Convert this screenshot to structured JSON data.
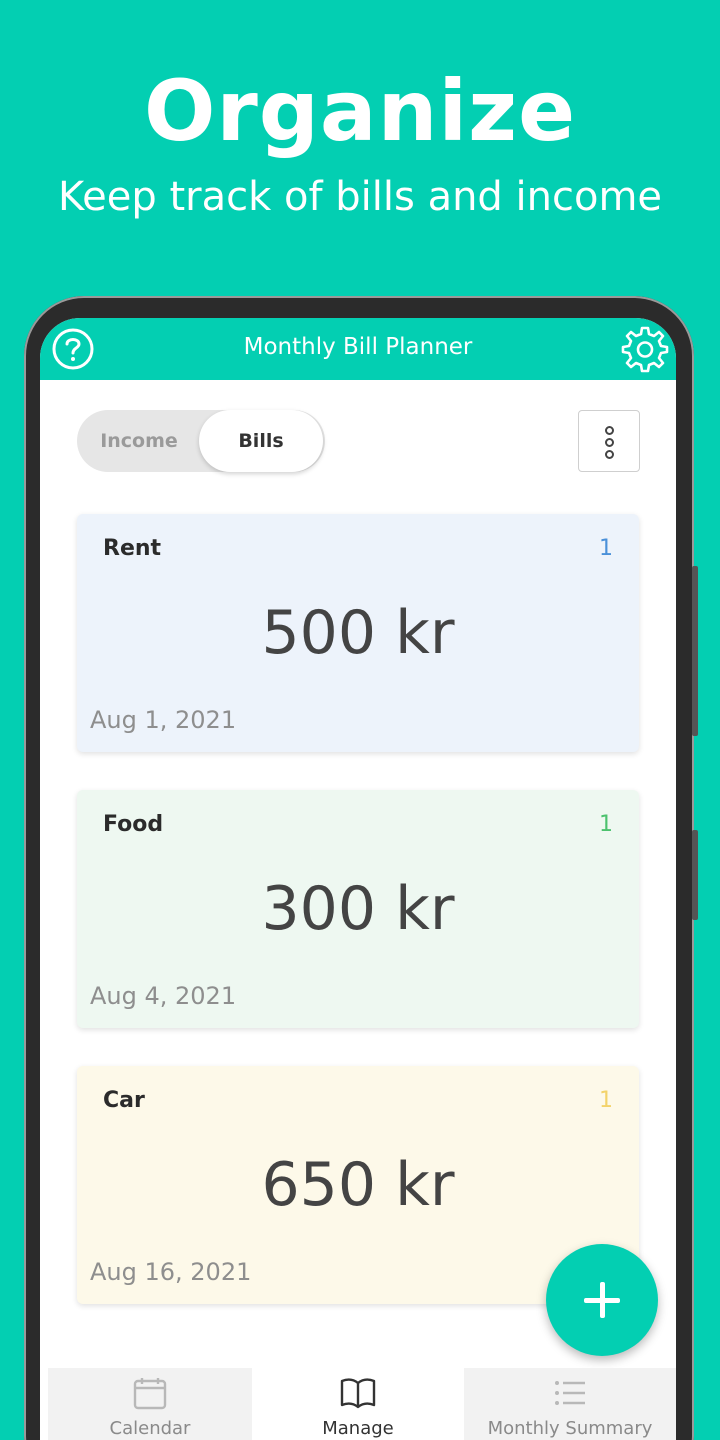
{
  "hero": {
    "title": "Organize",
    "subtitle": "Keep track of bills and income"
  },
  "appbar": {
    "title": "Monthly Bill Planner",
    "help_icon": "help-circle-icon",
    "settings_icon": "gear-icon"
  },
  "toggle": {
    "income_label": "Income",
    "bills_label": "Bills",
    "selected": "Bills"
  },
  "menu_icon": "more-vertical-icon",
  "bills": [
    {
      "name": "Rent",
      "count": "1",
      "amount": "500 kr",
      "date": "Aug 1, 2021",
      "bg": "#edf3fb",
      "accent": "#4a90d9"
    },
    {
      "name": "Food",
      "count": "1",
      "amount": "300 kr",
      "date": "Aug 4, 2021",
      "bg": "#eef8f1",
      "accent": "#4cc26e"
    },
    {
      "name": "Car",
      "count": "1",
      "amount": "650 kr",
      "date": "Aug 16, 2021",
      "bg": "#fdf9e9",
      "accent": "#f3d36a"
    }
  ],
  "fab_icon": "plus-icon",
  "nav": {
    "items": [
      {
        "label": "Calendar",
        "icon": "calendar-icon",
        "active": false
      },
      {
        "label": "Manage",
        "icon": "book-icon",
        "active": true
      },
      {
        "label": "Monthly Summary",
        "icon": "list-icon",
        "active": false
      }
    ]
  },
  "colors": {
    "brand": "#03cfb2",
    "active_nav_bg": "#ffffff",
    "inactive_nav_bg": "#f2f2f2"
  }
}
